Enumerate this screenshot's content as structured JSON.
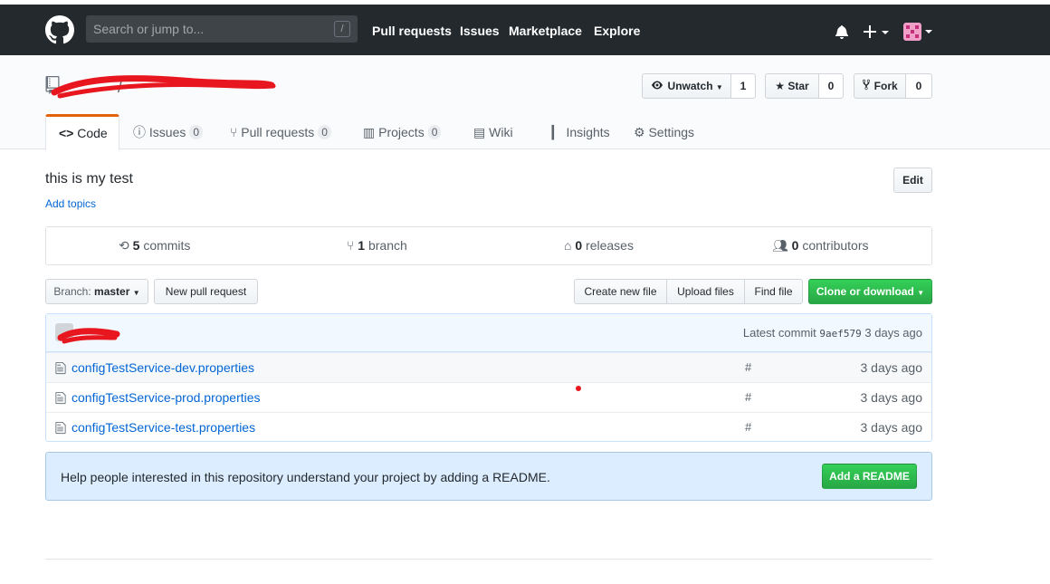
{
  "header": {
    "search_placeholder": "Search or jump to...",
    "slash_key": "/",
    "nav": [
      "Pull requests",
      "Issues",
      "Marketplace",
      "Explore"
    ]
  },
  "repo": {
    "name_separator": "/",
    "watch_label": "Unwatch",
    "watch_count": "1",
    "star_label": "Star",
    "star_count": "0",
    "fork_label": "Fork",
    "fork_count": "0"
  },
  "tabs": [
    {
      "label": "Code",
      "icon": "code-icon"
    },
    {
      "label": "Issues",
      "count": "0",
      "icon": "issue-icon"
    },
    {
      "label": "Pull requests",
      "count": "0",
      "icon": "pull-request-icon"
    },
    {
      "label": "Projects",
      "count": "0",
      "icon": "project-icon"
    },
    {
      "label": "Wiki",
      "icon": "book-icon"
    },
    {
      "label": "Insights",
      "icon": "graph-icon"
    },
    {
      "label": "Settings",
      "icon": "gear-icon"
    }
  ],
  "description": "this is my test",
  "edit_label": "Edit",
  "add_topics": "Add topics",
  "summary": {
    "commits_num": "5",
    "commits_label": "commits",
    "branch_num": "1",
    "branch_label": "branch",
    "releases_num": "0",
    "releases_label": "releases",
    "contributors_num": "0",
    "contributors_label": "contributors"
  },
  "toolbar": {
    "branch_prefix": "Branch:",
    "branch_name": "master",
    "new_pr": "New pull request",
    "create_file": "Create new file",
    "upload_files": "Upload files",
    "find_file": "Find file",
    "clone": "Clone or download"
  },
  "commit": {
    "latest_label": "Latest commit",
    "sha": "9aef579",
    "age": "3 days ago"
  },
  "files": [
    {
      "name": "configTestService-dev.properties",
      "message": "#",
      "age": "3 days ago"
    },
    {
      "name": "configTestService-prod.properties",
      "message": "#",
      "age": "3 days ago"
    },
    {
      "name": "configTestService-test.properties",
      "message": "#",
      "age": "3 days ago"
    }
  ],
  "readme": {
    "text": "Help people interested in this repository understand your project by adding a README.",
    "button": "Add a README"
  },
  "colors": {
    "header_bg": "#24292e",
    "link": "#0366d6",
    "green": "#28a745",
    "tab_accent": "#e36209",
    "redaction": "#e8171f"
  }
}
